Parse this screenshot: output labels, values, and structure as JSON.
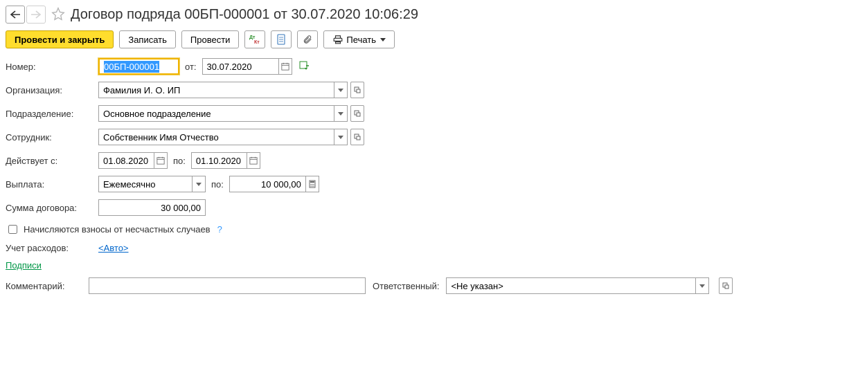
{
  "header": {
    "title": "Договор подряда 00БП-000001 от 30.07.2020 10:06:29"
  },
  "toolbar": {
    "post_close": "Провести и закрыть",
    "save": "Записать",
    "post": "Провести",
    "print": "Печать"
  },
  "labels": {
    "number": "Номер:",
    "from": "от:",
    "org": "Организация:",
    "dept": "Подразделение:",
    "employee": "Сотрудник:",
    "valid_from": "Действует с:",
    "to": "по:",
    "payment": "Выплата:",
    "pay_by": "по:",
    "sum": "Сумма договора:",
    "accident_check": "Начисляются взносы от несчастных случаев",
    "expense": "Учет расходов:",
    "signatures": "Подписи",
    "comment": "Комментарий:",
    "responsible": "Ответственный:"
  },
  "fields": {
    "number": "00БП-000001",
    "date": "30.07.2020",
    "org": "Фамилия И. О. ИП",
    "dept": "Основное подразделение",
    "employee": "Собственник Имя Отчество",
    "valid_from": "01.08.2020",
    "valid_to": "01.10.2020",
    "payment": "Ежемесячно",
    "pay_amount": "10 000,00",
    "sum": "30 000,00",
    "expense_link": "<Авто>",
    "comment": "",
    "responsible": "<Не указан>"
  }
}
